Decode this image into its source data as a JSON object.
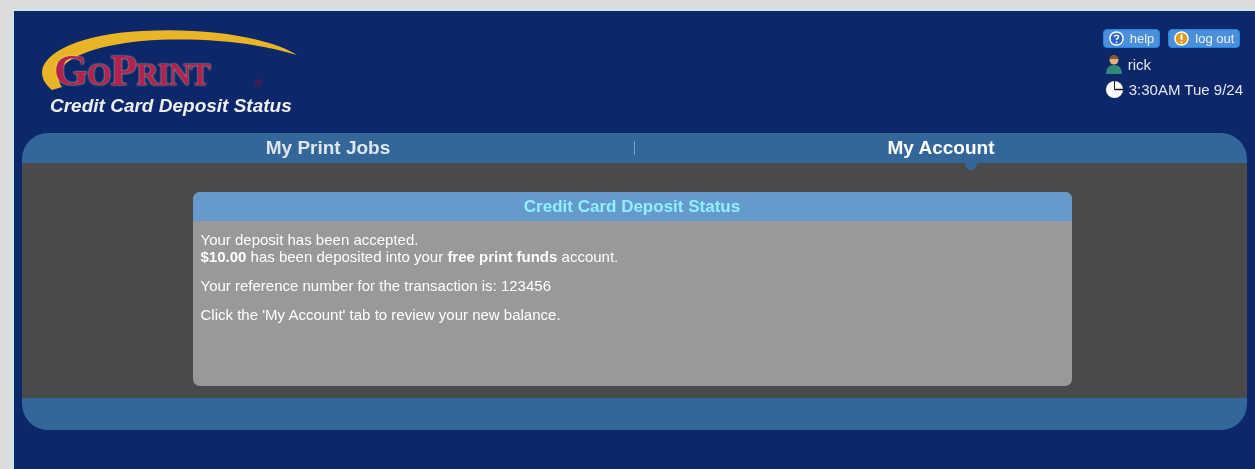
{
  "logo": {
    "text": "GoPrint",
    "mark": "®"
  },
  "page_title": "Credit Card Deposit Status",
  "header_buttons": [
    {
      "label": "help",
      "kind": "help"
    },
    {
      "label": "log out",
      "kind": "logout"
    }
  ],
  "user": "rick",
  "datetime": "3:30AM Tue 9/24",
  "tabs": [
    {
      "label": "My Print Jobs",
      "selected": false
    },
    {
      "label": "My Account",
      "selected": true
    }
  ],
  "panel": {
    "title": "Credit Card Deposit Status",
    "lines": [
      "Your deposit has been accepted.",
      "**$10.00** has been deposited into your **free print funds** account.",
      "Your reference number for the transaction is: 123456",
      "Click the 'My Account' tab to review your new balance."
    ]
  }
}
